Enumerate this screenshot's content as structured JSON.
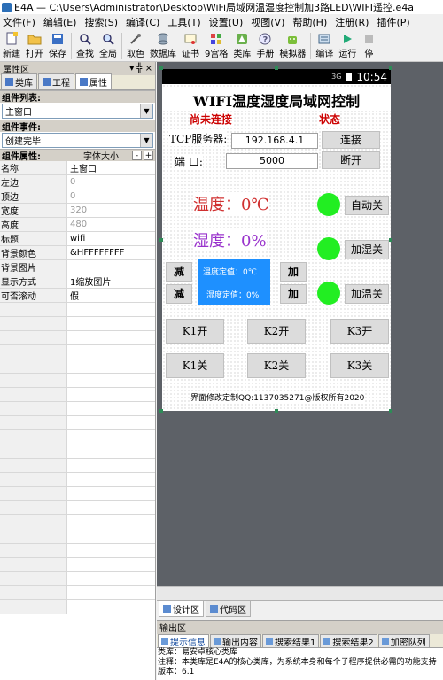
{
  "window": {
    "title": "E4A — C:\\Users\\Administrator\\Desktop\\WiFi局域网温湿度控制加3路LED\\WIFI遥控.e4a"
  },
  "menu": [
    "文件(F)",
    "编辑(E)",
    "搜索(S)",
    "编译(C)",
    "工具(T)",
    "设置(U)",
    "视图(V)",
    "帮助(H)",
    "注册(R)",
    "插件(P)"
  ],
  "toolbar": [
    {
      "label": "新建",
      "icon": "new-file-icon"
    },
    {
      "label": "打开",
      "icon": "open-folder-icon"
    },
    {
      "label": "保存",
      "icon": "save-icon"
    },
    {
      "label": "查找",
      "icon": "find-icon"
    },
    {
      "label": "全局",
      "icon": "global-search-icon"
    },
    {
      "label": "取色",
      "icon": "color-picker-icon"
    },
    {
      "label": "数据库",
      "icon": "database-icon"
    },
    {
      "label": "证书",
      "icon": "certificate-icon"
    },
    {
      "label": "9宫格",
      "icon": "grid-icon"
    },
    {
      "label": "类库",
      "icon": "library-icon"
    },
    {
      "label": "手册",
      "icon": "manual-icon"
    },
    {
      "label": "模拟器",
      "icon": "emulator-icon"
    },
    {
      "label": "编译",
      "icon": "compile-icon"
    },
    {
      "label": "运行",
      "icon": "run-icon"
    },
    {
      "label": "停",
      "icon": "stop-icon"
    }
  ],
  "left_panel": {
    "title": "属性区",
    "controls": "▾ ╬ ×",
    "tabs": [
      "类库",
      "工程",
      "属性"
    ],
    "component_list_label": "组件列表:",
    "component_list_value": "主窗口",
    "component_event_label": "组件事件:",
    "component_event_value": "创建完毕",
    "component_attr_label": "组件属性:",
    "font_size_label": "字体大小",
    "minus": "-",
    "plus": "+",
    "properties": [
      {
        "key": "名称",
        "value": "主窗口",
        "grey": false
      },
      {
        "key": "左边",
        "value": "0",
        "grey": true
      },
      {
        "key": "顶边",
        "value": "0",
        "grey": true
      },
      {
        "key": "宽度",
        "value": "320",
        "grey": true
      },
      {
        "key": "高度",
        "value": "480",
        "grey": true
      },
      {
        "key": "标题",
        "value": "wifi",
        "grey": false
      },
      {
        "key": "背景颜色",
        "value": "&HFFFFFFFF",
        "grey": false
      },
      {
        "key": "背景图片",
        "value": "",
        "grey": false
      },
      {
        "key": "显示方式",
        "value": "1缩放图片",
        "grey": false
      },
      {
        "key": "可否滚动",
        "value": "假",
        "grey": false
      }
    ]
  },
  "phone": {
    "time": "10:54",
    "signal": "3G",
    "title": "WIFI温度湿度局域网控制",
    "connection_status": "尚未连接",
    "status_label": "状态",
    "tcp_label": "TCP服务器:",
    "ip_value": "192.168.4.1",
    "connect_button": "连接",
    "port_label": "端  口:",
    "port_value": "5000",
    "disconnect_button": "断开",
    "temperature": "温度：0℃",
    "auto_off_button": "自动关",
    "humidity": "湿度：0%",
    "humidify_off_button": "加湿关",
    "minus_button": "减",
    "plus_button": "加",
    "temp_setpoint": "温度定值：0℃",
    "hum_setpoint": "湿度定值：0%",
    "heat_off_button": "加温关",
    "k1_on": "K1开",
    "k2_on": "K2开",
    "k3_on": "K3开",
    "k1_off": "K1关",
    "k2_off": "K2关",
    "k3_off": "K3关",
    "footer": "界面修改定制QQ:1137035271@版权所有2020"
  },
  "designer_tabs": [
    "设计区",
    "代码区"
  ],
  "output": {
    "title": "输出区",
    "tabs": [
      "提示信息",
      "输出内容",
      "搜索结果1",
      "搜索结果2",
      "加密队列"
    ],
    "lines": [
      "类库：易安卓核心类库",
      "注释：本类库是E4A的核心类库，为系统本身和每个子程序提供必需的功能支持",
      "版本：6.1"
    ]
  },
  "colors": {
    "led": "#22ee22",
    "setpoint_bg": "#1e90ff",
    "temp_text": "#d03030",
    "hum_text": "#9933cc",
    "status_red": "#cc0000"
  }
}
